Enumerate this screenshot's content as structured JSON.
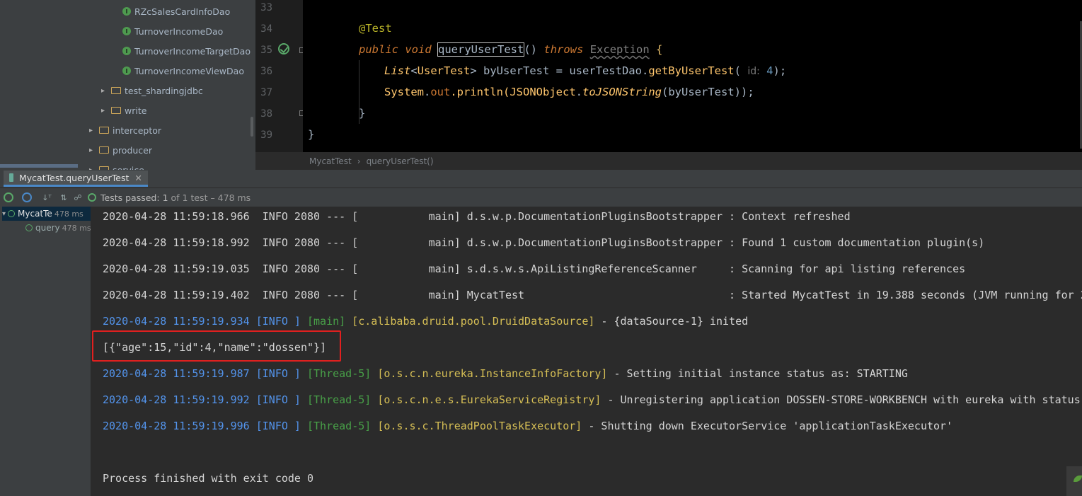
{
  "project_tree": {
    "items": [
      {
        "label": "RZcSalesCardInfoDao",
        "kind": "interface"
      },
      {
        "label": "TurnoverIncomeDao",
        "kind": "interface"
      },
      {
        "label": "TurnoverIncomeTargetDao",
        "kind": "interface"
      },
      {
        "label": "TurnoverIncomeViewDao",
        "kind": "interface"
      },
      {
        "label": "test_shardingjdbc",
        "kind": "folder"
      },
      {
        "label": "write",
        "kind": "folder"
      },
      {
        "label": "interceptor",
        "kind": "folder"
      },
      {
        "label": "producer",
        "kind": "folder"
      },
      {
        "label": "service",
        "kind": "folder"
      }
    ]
  },
  "editor": {
    "line_numbers": [
      "33",
      "34",
      "35",
      "36",
      "37",
      "38",
      "39"
    ],
    "annotation": "@Test",
    "kw_public": "public",
    "kw_void": "void",
    "method_name": "queryUserTest",
    "paren_open": "()",
    "kw_throws": "throws",
    "exception": "Exception",
    "brace_open": "{",
    "l36_type": "List",
    "l36_generic_open": "<",
    "l36_generic_type": "UserTest",
    "l36_generic_close": ">",
    "l36_rest": " byUserTest = userTestDao.",
    "l36_method": "getByUserTest",
    "l36_paren": "(",
    "l36_hint": "id:",
    "l36_num": "4",
    "l36_end": ");",
    "l37_system": "System",
    "l37_dot": ".",
    "l37_out": "out",
    "l37_println": ".println(",
    "l37_json": "JSONObject",
    "l37_dot2": ".",
    "l37_tojson": "toJSONString",
    "l37_end": "(byUserTest));",
    "l38": "}",
    "l39": "}"
  },
  "breadcrumb": {
    "class": "MycatTest",
    "sep": "›",
    "method": "queryUserTest()"
  },
  "run_tab": {
    "label": "MycatTest.queryUserTest",
    "close": "✕"
  },
  "test_toolbar": {
    "status_label": "Tests passed:",
    "passed": "1",
    "rest": "of 1 test – 478 ms"
  },
  "test_tree": {
    "root": {
      "label": "MycatTe",
      "duration": "478 ms"
    },
    "child": {
      "label": "query",
      "duration": "478 ms"
    }
  },
  "console": {
    "lines": [
      {
        "text": "2020-04-28 11:59:18.966  INFO 2080 --- [           main] d.s.w.p.DocumentationPluginsBootstrapper : Context refreshed"
      },
      {
        "text": "2020-04-28 11:59:18.992  INFO 2080 --- [           main] d.s.w.p.DocumentationPluginsBootstrapper : Found 1 custom documentation plugin(s)"
      },
      {
        "text": "2020-04-28 11:59:19.035  INFO 2080 --- [           main] s.d.s.w.s.ApiListingReferenceScanner     : Scanning for api listing references"
      },
      {
        "text": "2020-04-28 11:59:19.402  INFO 2080 --- [           main] MycatTest                                : Started MycatTest in 19.388 seconds (JVM running for 2"
      }
    ],
    "log5": {
      "time": "2020-04-28 11:59:19.934",
      "level": "[INFO ]",
      "thread": "[main]",
      "logger": "[c.alibaba.druid.pool.DruidDataSource]",
      "msg": " - {dataSource-1} inited"
    },
    "json_output": "[{\"age\":15,\"id\":4,\"name\":\"dossen\"}]",
    "log7": {
      "time": "2020-04-28 11:59:19.987",
      "level": "[INFO ]",
      "thread": "[Thread-5]",
      "logger": "[o.s.c.n.eureka.InstanceInfoFactory]",
      "msg": " - Setting initial instance status as: STARTING"
    },
    "log8": {
      "time": "2020-04-28 11:59:19.992",
      "level": "[INFO ]",
      "thread": "[Thread-5]",
      "logger": "[o.s.c.n.e.s.EurekaServiceRegistry]",
      "msg": " - Unregistering application DOSSEN-STORE-WORKBENCH with eureka with status"
    },
    "log9": {
      "time": "2020-04-28 11:59:19.996",
      "level": "[INFO ]",
      "thread": "[Thread-5]",
      "logger": "[o.s.s.c.ThreadPoolTaskExecutor]",
      "msg": " - Shutting down ExecutorService 'applicationTaskExecutor'"
    },
    "exit": "Process finished with exit code 0"
  }
}
